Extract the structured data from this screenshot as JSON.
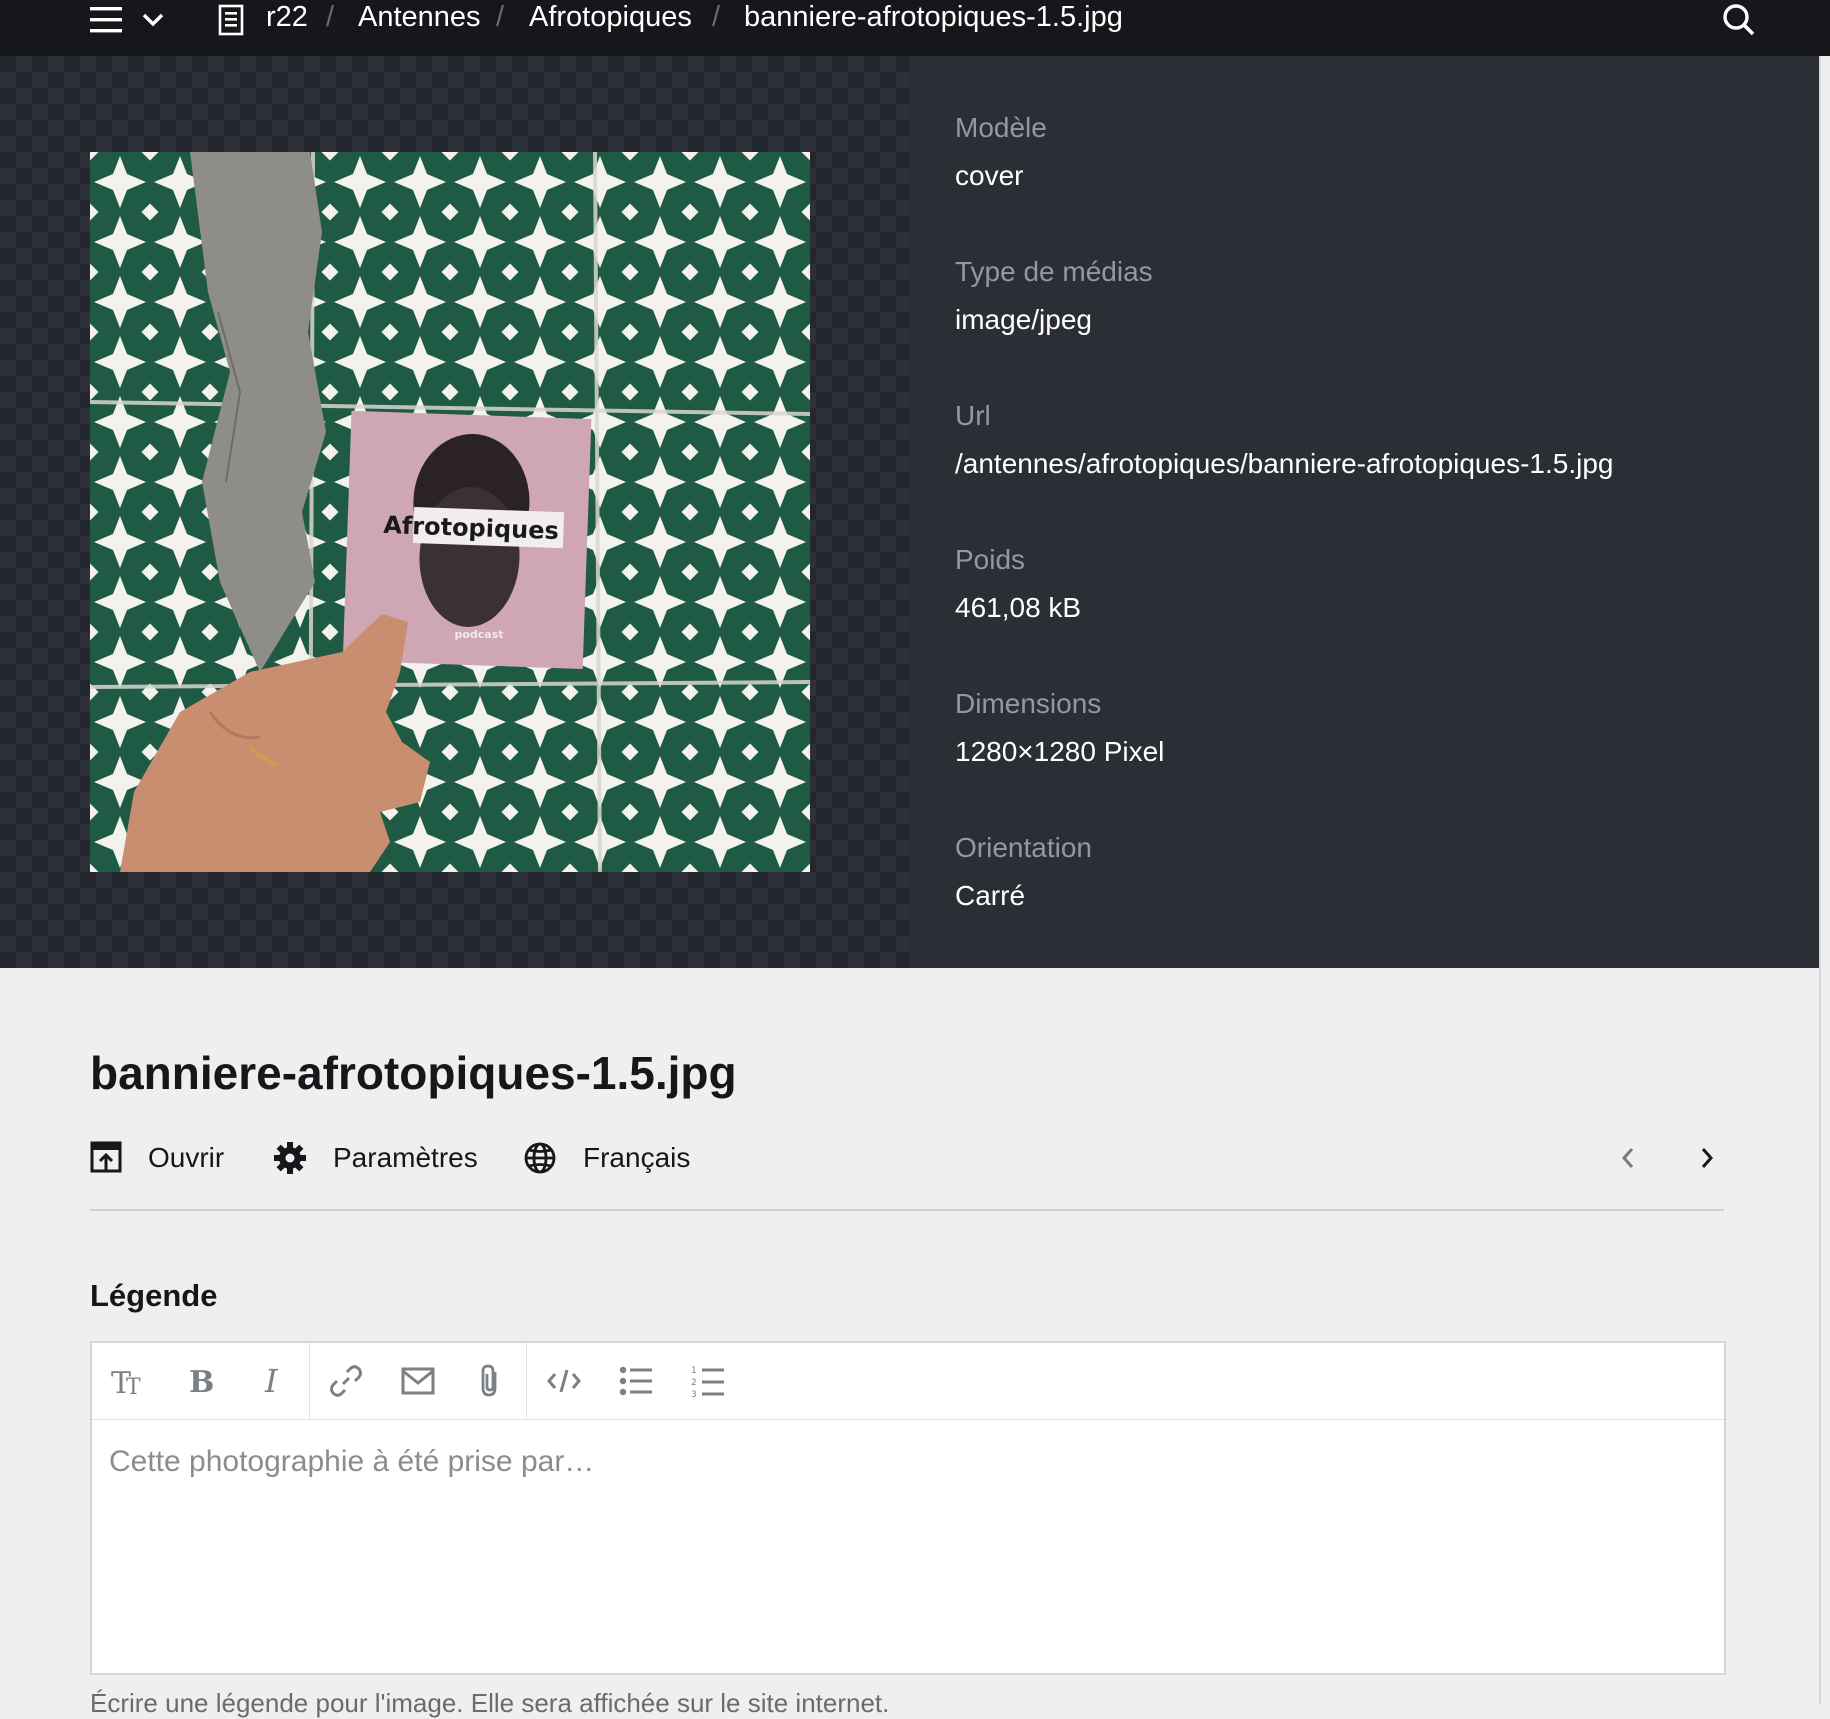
{
  "topbar": {
    "breadcrumbs": [
      "r22",
      "Antennes",
      "Afrotopiques",
      "banniere-afrotopiques-1.5.jpg"
    ],
    "separator": "/"
  },
  "preview": {
    "card_title": "Afrotopiques",
    "card_subtitle": "podcast"
  },
  "info": {
    "items": [
      {
        "label": "Modèle",
        "value": "cover"
      },
      {
        "label": "Type de médias",
        "value": "image/jpeg"
      },
      {
        "label": "Url",
        "value": "/antennes/afrotopiques/banniere-afrotopiques-1.5.jpg"
      },
      {
        "label": "Poids",
        "value": "461,08 kB"
      },
      {
        "label": "Dimensions",
        "value": "1280×1280 Pixel"
      },
      {
        "label": "Orientation",
        "value": "Carré"
      }
    ]
  },
  "page": {
    "title": "banniere-afrotopiques-1.5.jpg",
    "actions": {
      "open": "Ouvrir",
      "settings": "Paramètres",
      "language": "Français"
    }
  },
  "caption": {
    "label": "Légende",
    "placeholder": "Cette photographie à été prise par…",
    "help": "Écrire une légende pour l'image. Elle sera affichée sur le site internet."
  },
  "colors": {
    "topbar": "#16171a",
    "info_panel": "#2b2e35",
    "tile_green": "#1f5a45"
  }
}
